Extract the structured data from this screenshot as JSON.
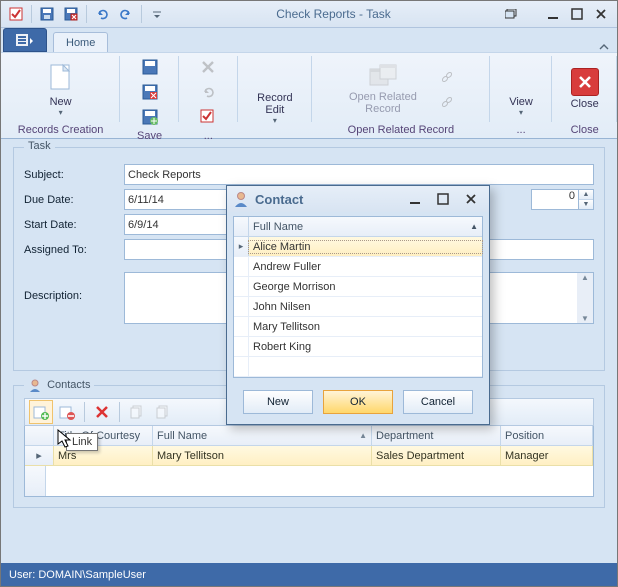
{
  "window": {
    "title": "Check Reports - Task"
  },
  "ribbon": {
    "tab_home": "Home",
    "groups": {
      "records_creation": "Records Creation",
      "save": "Save",
      "edit_ell": "...",
      "open_related": "Open Related Record",
      "view_ell": "...",
      "close": "Close"
    },
    "buttons": {
      "new": "New",
      "record_edit": "Record\nEdit",
      "open_related_record": "Open Related\nRecord",
      "view": "View",
      "close": "Close"
    }
  },
  "task": {
    "legend": "Task",
    "labels": {
      "subject": "Subject:",
      "due_date": "Due Date:",
      "start_date": "Start Date:",
      "assigned_to": "Assigned To:",
      "description": "Description:"
    },
    "values": {
      "subject": "Check Reports",
      "due_date": "6/11/14",
      "start_date": "6/9/14",
      "assigned_to": "",
      "spin": "0"
    }
  },
  "contacts": {
    "legend": "Contacts",
    "columns": {
      "title_courtesy": "Title Of Courtesy",
      "full_name": "Full Name",
      "department": "Department",
      "position": "Position"
    },
    "row": {
      "title": "Mrs",
      "full_name": "Mary Tellitson",
      "department": "Sales Department",
      "position": "Manager"
    },
    "tooltip": "Link"
  },
  "dialog": {
    "title": "Contact",
    "head": "Full Name",
    "items": [
      "Alice Martin",
      "Andrew Fuller",
      "George Morrison",
      "John Nilsen",
      "Mary Tellitson",
      "Robert King"
    ],
    "buttons": {
      "new": "New",
      "ok": "OK",
      "cancel": "Cancel"
    }
  },
  "status": "User: DOMAIN\\SampleUser"
}
